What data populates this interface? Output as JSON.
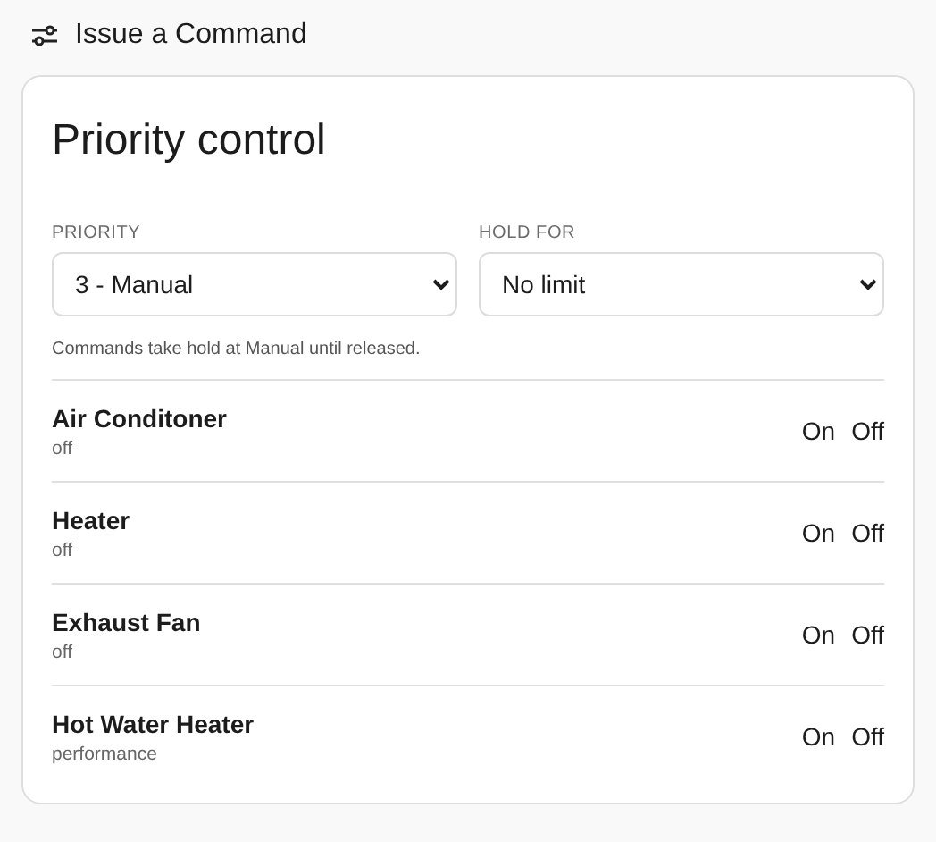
{
  "header": {
    "title": "Issue a Command"
  },
  "card": {
    "title": "Priority control",
    "fields": [
      {
        "label": "PRIORITY",
        "value": "3 - Manual"
      },
      {
        "label": "HOLD FOR",
        "value": "No limit"
      }
    ],
    "note": "Commands take hold at Manual until released.",
    "devices": [
      {
        "name": "Air Conditoner",
        "status": "off",
        "actions": [
          "On",
          "Off"
        ]
      },
      {
        "name": "Heater",
        "status": "off",
        "actions": [
          "On",
          "Off"
        ]
      },
      {
        "name": "Exhaust Fan",
        "status": "off",
        "actions": [
          "On",
          "Off"
        ]
      },
      {
        "name": "Hot Water Heater",
        "status": "performance",
        "actions": [
          "On",
          "Off"
        ]
      }
    ]
  }
}
